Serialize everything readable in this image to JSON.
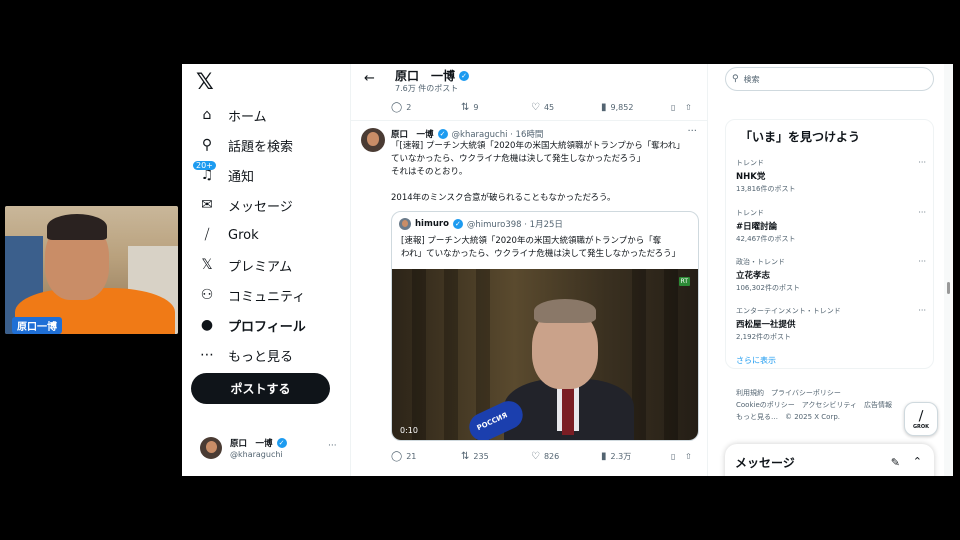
{
  "webcam": {
    "name_tag": "原口一博"
  },
  "nav": {
    "logo": "𝕏",
    "notification_badge": "20+",
    "items": [
      {
        "label": "ホーム",
        "icon": "home-icon",
        "glyph": "⌂"
      },
      {
        "label": "話題を検索",
        "icon": "search-icon",
        "glyph": "⚲"
      },
      {
        "label": "通知",
        "icon": "bell-icon",
        "glyph": "♫"
      },
      {
        "label": "メッセージ",
        "icon": "mail-icon",
        "glyph": "✉"
      },
      {
        "label": "Grok",
        "icon": "grok-icon",
        "glyph": "⧸"
      },
      {
        "label": "プレミアム",
        "icon": "x-premium-icon",
        "glyph": "𝕏"
      },
      {
        "label": "コミュニティ",
        "icon": "community-icon",
        "glyph": "⚇"
      },
      {
        "label": "プロフィール",
        "icon": "profile-icon",
        "glyph": "●"
      },
      {
        "label": "もっと見る",
        "icon": "more-icon",
        "glyph": "⋯"
      }
    ],
    "post_button": "ポストする",
    "account": {
      "name": "原口　一博",
      "handle": "@kharaguchi",
      "more": "···"
    }
  },
  "header": {
    "name": "原口　一博",
    "subtitle": "7.6万 件のポスト",
    "back": "←"
  },
  "prev_actions": {
    "replies": "2",
    "reposts": "9",
    "likes": "45",
    "views": "9,852"
  },
  "post": {
    "author": "原口　一博",
    "handle": "@kharaguchi · 16時間",
    "more": "···",
    "lines": [
      "「[速報] プーチン大統領「2020年の米国大統領職がトランプから「奪われ」",
      "ていなかったら、ウクライナ危機は決して発生しなかっただろう」",
      "それはそのとおり。",
      "",
      "2014年のミンスク合意が破られることもなかっただろう。"
    ],
    "quote": {
      "author": "himuro",
      "handle": "@himuro398 · 1月25日",
      "lines": [
        "[速報] プーチン大統領「2020年の米国大統領職がトランプから「奪",
        "われ」ていなかったら、ウクライナ危機は決して発生しなかっただろう」"
      ],
      "video_time": "0:10",
      "video_badge": "RT",
      "mic_text": "РОССИЯ"
    },
    "actions": {
      "replies": "21",
      "reposts": "235",
      "likes": "826",
      "views": "2.3万"
    }
  },
  "right": {
    "search_placeholder": "検索",
    "trends_title": "「いま」を見つけよう",
    "trends": [
      {
        "context": "トレンド",
        "topic": "NHK党",
        "posts": "13,816件のポスト"
      },
      {
        "context": "トレンド",
        "topic": "#日曜討論",
        "posts": "42,467件のポスト"
      },
      {
        "context": "政治・トレンド",
        "topic": "立花孝志",
        "posts": "106,302件のポスト"
      },
      {
        "context": "エンターテインメント・トレンド",
        "topic": "西松屋一社提供",
        "posts": "2,192件のポスト"
      }
    ],
    "show_more": "さらに表示",
    "footer": [
      "利用規約　プライバシーポリシー",
      "Cookieのポリシー　アクセシビリティ　広告情報",
      "もっと見る…　© 2025 X Corp."
    ],
    "grok_label": "GROK",
    "messages_title": "メッセージ"
  }
}
